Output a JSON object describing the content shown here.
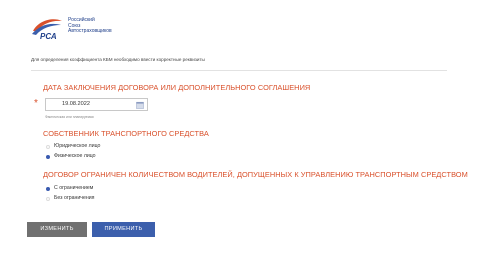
{
  "header": {
    "logo_line1": "Российский",
    "logo_line2": "Союз",
    "logo_line3": "Автостраховщиков",
    "logo_abbrev": "РСА"
  },
  "intro_text": "Для определения коэффициента КБМ необходимо ввести корректные реквизиты",
  "sections": {
    "contract_date": {
      "title": "ДАТА ЗАКЛЮЧЕНИЯ ДОГОВОРА ИЛИ ДОПОЛНИТЕЛЬНОГО СОГЛАШЕНИЯ",
      "value": "19.08.2022",
      "hint": "Фактическая или планируемая",
      "required_mark": "*"
    },
    "owner": {
      "title": "СОБСТВЕННИК ТРАНСПОРТНОГО СРЕДСТВА",
      "options": [
        {
          "label": "Юридическое лицо",
          "selected": false
        },
        {
          "label": "Физическое лицо",
          "selected": true
        }
      ]
    },
    "drivers": {
      "title": "ДОГОВОР ОГРАНИЧЕН КОЛИЧЕСТВОМ ВОДИТЕЛЕЙ, ДОПУЩЕННЫХ К УПРАВЛЕНИЮ ТРАНСПОРТНЫМ СРЕДСТВОМ",
      "options": [
        {
          "label": "С ограничением",
          "selected": true
        },
        {
          "label": "Без ограничения",
          "selected": false
        }
      ]
    }
  },
  "buttons": {
    "change_label": "ИЗМЕНИТЬ",
    "apply_label": "ПРИМЕНИТЬ"
  },
  "colors": {
    "accent_red": "#d9502b",
    "brand_blue": "#3c5fac",
    "button_grey": "#707070"
  },
  "icons": {
    "calendar": "calendar-icon",
    "logo": "rsa-logo"
  }
}
